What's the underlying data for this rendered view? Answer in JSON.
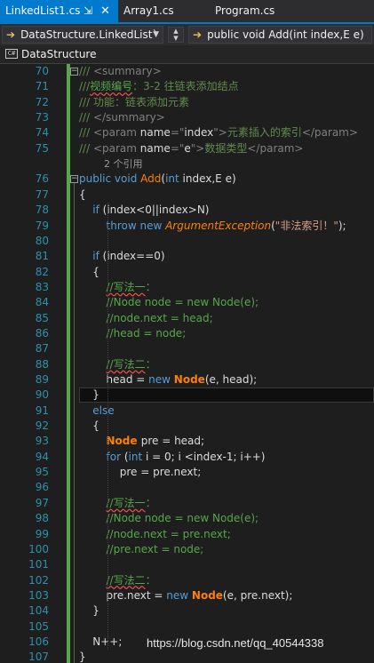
{
  "tabs": [
    {
      "label": "LinkedList1.cs",
      "active": true,
      "pin_icon": "pin-icon",
      "close_icon": "close-icon"
    },
    {
      "label": "Array1.cs",
      "active": false
    },
    {
      "label": "Program.cs",
      "active": false
    }
  ],
  "navbar": {
    "type_dropdown": "DataStructure.LinkedList`",
    "member_dropdown": "public void Add(int index,E e)"
  },
  "namespace_bar": {
    "icon": "cs-namespace-icon",
    "label": "DataStructure"
  },
  "lines": [
    {
      "n": "70",
      "tokens": [
        [
          "dt",
          "/// "
        ],
        [
          "xt",
          "<summary>"
        ]
      ]
    },
    {
      "n": "71",
      "tokens": [
        [
          "dt",
          "///"
        ],
        [
          "cmsq",
          "视频编号"
        ],
        [
          "dt",
          "：3-2 往链表添加结点"
        ]
      ]
    },
    {
      "n": "72",
      "tokens": [
        [
          "dt",
          "/// 功能：链表添加元素"
        ]
      ]
    },
    {
      "n": "73",
      "tokens": [
        [
          "dt",
          "/// "
        ],
        [
          "xt",
          "</summary>"
        ]
      ]
    },
    {
      "n": "74",
      "tokens": [
        [
          "dt",
          "/// "
        ],
        [
          "xt",
          "<param "
        ],
        [
          "id",
          "name"
        ],
        [
          "xt",
          "=\""
        ],
        [
          "id",
          "index"
        ],
        [
          "xt",
          "\">"
        ],
        [
          "dt",
          "元素插入的索引"
        ],
        [
          "xt",
          "</param>"
        ]
      ]
    },
    {
      "n": "75",
      "tokens": [
        [
          "dt",
          "/// "
        ],
        [
          "xt",
          "<param "
        ],
        [
          "id",
          "name"
        ],
        [
          "xt",
          "=\""
        ],
        [
          "id",
          "e"
        ],
        [
          "xt",
          "\">"
        ],
        [
          "dt",
          "数据类型"
        ],
        [
          "xt",
          "</param>"
        ]
      ]
    },
    {
      "n": "",
      "ref": "2 个引用"
    },
    {
      "n": "76",
      "tokens": [
        [
          "kw",
          "public "
        ],
        [
          "kw",
          "void "
        ],
        [
          "mt",
          "Add"
        ],
        [
          "id",
          "("
        ],
        [
          "kw",
          "int "
        ],
        [
          "id",
          "index,E e)"
        ]
      ]
    },
    {
      "n": "77",
      "tokens": [
        [
          "id",
          "{"
        ]
      ]
    },
    {
      "n": "78",
      "tokens": [
        [
          "id",
          "    "
        ],
        [
          "kw",
          "if "
        ],
        [
          "id",
          "(index<0||index>N)"
        ]
      ]
    },
    {
      "n": "79",
      "tokens": [
        [
          "id",
          "        "
        ],
        [
          "kw",
          "throw "
        ],
        [
          "kw",
          "new "
        ],
        [
          "ex",
          "ArgumentException"
        ],
        [
          "id",
          "("
        ],
        [
          "st",
          "\"非法索引！\""
        ],
        [
          "id",
          ");"
        ]
      ]
    },
    {
      "n": "80",
      "tokens": []
    },
    {
      "n": "81",
      "tokens": [
        [
          "id",
          "    "
        ],
        [
          "kw",
          "if "
        ],
        [
          "id",
          "(index==0)"
        ]
      ]
    },
    {
      "n": "82",
      "tokens": [
        [
          "id",
          "    {"
        ]
      ]
    },
    {
      "n": "83",
      "tokens": [
        [
          "id",
          "        "
        ],
        [
          "cmsq",
          "//写法一"
        ],
        [
          "cm",
          "："
        ]
      ]
    },
    {
      "n": "84",
      "tokens": [
        [
          "id",
          "        "
        ],
        [
          "cm",
          "//Node node = new Node(e);"
        ]
      ]
    },
    {
      "n": "85",
      "tokens": [
        [
          "id",
          "        "
        ],
        [
          "cm",
          "//node.next = head;"
        ]
      ]
    },
    {
      "n": "86",
      "tokens": [
        [
          "id",
          "        "
        ],
        [
          "cm",
          "//head = node;"
        ]
      ]
    },
    {
      "n": "87",
      "tokens": []
    },
    {
      "n": "88",
      "tokens": [
        [
          "id",
          "        "
        ],
        [
          "cmsq",
          "//写法二"
        ],
        [
          "cm",
          "："
        ]
      ]
    },
    {
      "n": "89",
      "tokens": [
        [
          "id",
          "        head = "
        ],
        [
          "kw",
          "new "
        ],
        [
          "cl",
          "Node"
        ],
        [
          "id",
          "(e, head);"
        ]
      ]
    },
    {
      "n": "90",
      "tokens": [
        [
          "id",
          "    }"
        ]
      ]
    },
    {
      "n": "91",
      "tokens": [
        [
          "id",
          "    "
        ],
        [
          "kw",
          "else"
        ]
      ]
    },
    {
      "n": "92",
      "tokens": [
        [
          "id",
          "    {"
        ]
      ]
    },
    {
      "n": "93",
      "tokens": [
        [
          "id",
          "        "
        ],
        [
          "cl",
          "Node "
        ],
        [
          "id",
          "pre = head;"
        ]
      ]
    },
    {
      "n": "94",
      "tokens": [
        [
          "id",
          "        "
        ],
        [
          "kw",
          "for "
        ],
        [
          "id",
          "("
        ],
        [
          "kw",
          "int "
        ],
        [
          "id",
          "i = 0; i <index-1; i++)"
        ]
      ]
    },
    {
      "n": "95",
      "tokens": [
        [
          "id",
          "            pre = pre.next;"
        ]
      ]
    },
    {
      "n": "96",
      "tokens": []
    },
    {
      "n": "97",
      "tokens": [
        [
          "id",
          "        "
        ],
        [
          "cmsq",
          "//写法一"
        ],
        [
          "cm",
          "："
        ]
      ]
    },
    {
      "n": "98",
      "tokens": [
        [
          "id",
          "        "
        ],
        [
          "cm",
          "//Node node = new Node(e);"
        ]
      ]
    },
    {
      "n": "99",
      "tokens": [
        [
          "id",
          "        "
        ],
        [
          "cm",
          "//node.next = pre.next;"
        ]
      ]
    },
    {
      "n": "100",
      "tokens": [
        [
          "id",
          "        "
        ],
        [
          "cm",
          "//pre.next = node;"
        ]
      ]
    },
    {
      "n": "101",
      "tokens": []
    },
    {
      "n": "102",
      "tokens": [
        [
          "id",
          "        "
        ],
        [
          "cmsq",
          "//写法二"
        ],
        [
          "cm",
          "："
        ]
      ]
    },
    {
      "n": "103",
      "tokens": [
        [
          "id",
          "        pre.next = "
        ],
        [
          "kw",
          "new "
        ],
        [
          "cl",
          "Node"
        ],
        [
          "id",
          "(e, pre.next);"
        ]
      ]
    },
    {
      "n": "104",
      "tokens": [
        [
          "id",
          "    }"
        ]
      ]
    },
    {
      "n": "105",
      "tokens": []
    },
    {
      "n": "106",
      "tokens": [
        [
          "id",
          "    N++;"
        ]
      ]
    },
    {
      "n": "107",
      "tokens": [
        [
          "id",
          "}"
        ]
      ]
    }
  ],
  "current_line": "90",
  "watermark": "https://blog.csdn.net/qq_40544338",
  "colors": {
    "accent": "#007acc",
    "line_number": "#2b91af",
    "keyword": "#569cd6",
    "comment": "#57a64a",
    "method": "#ff8000",
    "string": "#d69d85"
  }
}
